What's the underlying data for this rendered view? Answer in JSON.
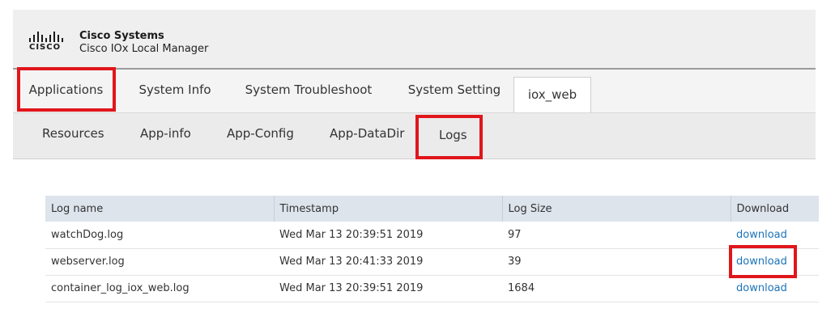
{
  "header": {
    "logo_text": "CISCO",
    "company": "Cisco Systems",
    "product": "Cisco IOx Local Manager"
  },
  "tabs": [
    {
      "label": "Applications"
    },
    {
      "label": "System Info"
    },
    {
      "label": "System Troubleshoot"
    },
    {
      "label": "System Setting"
    },
    {
      "label": "iox_web",
      "active": true
    }
  ],
  "subtabs": [
    {
      "label": "Resources"
    },
    {
      "label": "App-info"
    },
    {
      "label": "App-Config"
    },
    {
      "label": "App-DataDir"
    },
    {
      "label": "Logs",
      "active": true
    }
  ],
  "logs_table": {
    "headers": [
      "Log name",
      "Timestamp",
      "Log Size",
      "Download"
    ],
    "rows": [
      {
        "name": "watchDog.log",
        "timestamp": "Wed Mar 13 20:39:51 2019",
        "size": "97",
        "download": "download"
      },
      {
        "name": "webserver.log",
        "timestamp": "Wed Mar 13 20:41:33 2019",
        "size": "39",
        "download": "download"
      },
      {
        "name": "container_log_iox_web.log",
        "timestamp": "Wed Mar 13 20:39:51 2019",
        "size": "1684",
        "download": "download"
      }
    ]
  },
  "colors": {
    "highlight": "#e0161b",
    "link": "#1b73b8",
    "table_header_bg": "#dde4ec"
  }
}
